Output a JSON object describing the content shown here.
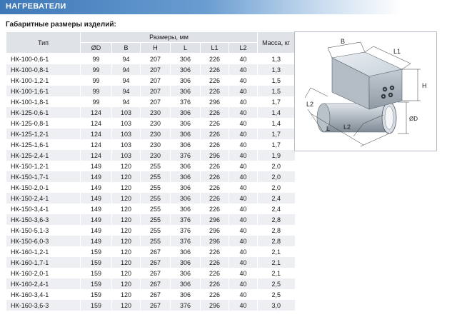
{
  "header": {
    "title": "НАГРЕВАТЕЛИ"
  },
  "subtitle": "Габаритные размеры изделий:",
  "table": {
    "headers": {
      "type": "Тип",
      "dimensions": "Размеры, мм",
      "mass": "Масса, кг",
      "d": "ØD",
      "b": "B",
      "h": "H",
      "l": "L",
      "l1": "L1",
      "l2": "L2"
    },
    "rows": [
      {
        "type": "НК-100-0,6-1",
        "d": "99",
        "b": "94",
        "h": "207",
        "l": "306",
        "l1": "226",
        "l2": "40",
        "mass": "1,3"
      },
      {
        "type": "НК-100-0,8-1",
        "d": "99",
        "b": "94",
        "h": "207",
        "l": "306",
        "l1": "226",
        "l2": "40",
        "mass": "1,3"
      },
      {
        "type": "НК-100-1,2-1",
        "d": "99",
        "b": "94",
        "h": "207",
        "l": "306",
        "l1": "226",
        "l2": "40",
        "mass": "1,5"
      },
      {
        "type": "НК-100-1,6-1",
        "d": "99",
        "b": "94",
        "h": "207",
        "l": "306",
        "l1": "226",
        "l2": "40",
        "mass": "1,5"
      },
      {
        "type": "НК-100-1,8-1",
        "d": "99",
        "b": "94",
        "h": "207",
        "l": "376",
        "l1": "296",
        "l2": "40",
        "mass": "1,7"
      },
      {
        "type": "НК-125-0,6-1",
        "d": "124",
        "b": "103",
        "h": "230",
        "l": "306",
        "l1": "226",
        "l2": "40",
        "mass": "1,4"
      },
      {
        "type": "НК-125-0,8-1",
        "d": "124",
        "b": "103",
        "h": "230",
        "l": "306",
        "l1": "226",
        "l2": "40",
        "mass": "1,4"
      },
      {
        "type": "НК-125-1,2-1",
        "d": "124",
        "b": "103",
        "h": "230",
        "l": "306",
        "l1": "226",
        "l2": "40",
        "mass": "1,7"
      },
      {
        "type": "НК-125-1,6-1",
        "d": "124",
        "b": "103",
        "h": "230",
        "l": "306",
        "l1": "226",
        "l2": "40",
        "mass": "1,7"
      },
      {
        "type": "НК-125-2,4-1",
        "d": "124",
        "b": "103",
        "h": "230",
        "l": "376",
        "l1": "296",
        "l2": "40",
        "mass": "1,9"
      },
      {
        "type": "НК-150-1,2-1",
        "d": "149",
        "b": "120",
        "h": "255",
        "l": "306",
        "l1": "226",
        "l2": "40",
        "mass": "2,0"
      },
      {
        "type": "НК-150-1,7-1",
        "d": "149",
        "b": "120",
        "h": "255",
        "l": "306",
        "l1": "226",
        "l2": "40",
        "mass": "2,0"
      },
      {
        "type": "НК-150-2,0-1",
        "d": "149",
        "b": "120",
        "h": "255",
        "l": "306",
        "l1": "226",
        "l2": "40",
        "mass": "2,0"
      },
      {
        "type": "НК-150-2,4-1",
        "d": "149",
        "b": "120",
        "h": "255",
        "l": "306",
        "l1": "226",
        "l2": "40",
        "mass": "2,4"
      },
      {
        "type": "НК-150-3,4-1",
        "d": "149",
        "b": "120",
        "h": "255",
        "l": "306",
        "l1": "226",
        "l2": "40",
        "mass": "2,4"
      },
      {
        "type": "НК-150-3,6-3",
        "d": "149",
        "b": "120",
        "h": "255",
        "l": "376",
        "l1": "296",
        "l2": "40",
        "mass": "2,8"
      },
      {
        "type": "НК-150-5,1-3",
        "d": "149",
        "b": "120",
        "h": "255",
        "l": "376",
        "l1": "296",
        "l2": "40",
        "mass": "2,8"
      },
      {
        "type": "НК-150-6,0-3",
        "d": "149",
        "b": "120",
        "h": "255",
        "l": "376",
        "l1": "296",
        "l2": "40",
        "mass": "2,8"
      },
      {
        "type": "НК-160-1,2-1",
        "d": "159",
        "b": "120",
        "h": "267",
        "l": "306",
        "l1": "226",
        "l2": "40",
        "mass": "2,1"
      },
      {
        "type": "НК-160-1,7-1",
        "d": "159",
        "b": "120",
        "h": "267",
        "l": "306",
        "l1": "226",
        "l2": "40",
        "mass": "2,1"
      },
      {
        "type": "НК-160-2,0-1",
        "d": "159",
        "b": "120",
        "h": "267",
        "l": "306",
        "l1": "226",
        "l2": "40",
        "mass": "2,1"
      },
      {
        "type": "НК-160-2,4-1",
        "d": "159",
        "b": "120",
        "h": "267",
        "l": "306",
        "l1": "226",
        "l2": "40",
        "mass": "2,5"
      },
      {
        "type": "НК-160-3,4-1",
        "d": "159",
        "b": "120",
        "h": "267",
        "l": "306",
        "l1": "226",
        "l2": "40",
        "mass": "2,5"
      },
      {
        "type": "НК-160-3,6-3",
        "d": "159",
        "b": "120",
        "h": "267",
        "l": "376",
        "l1": "296",
        "l2": "40",
        "mass": "3,0"
      }
    ]
  },
  "diagram": {
    "labels": {
      "b": "B",
      "l1": "L1",
      "l": "L",
      "l2_top": "L2",
      "l2_bottom": "L2",
      "h": "H",
      "d": "ØD"
    }
  }
}
